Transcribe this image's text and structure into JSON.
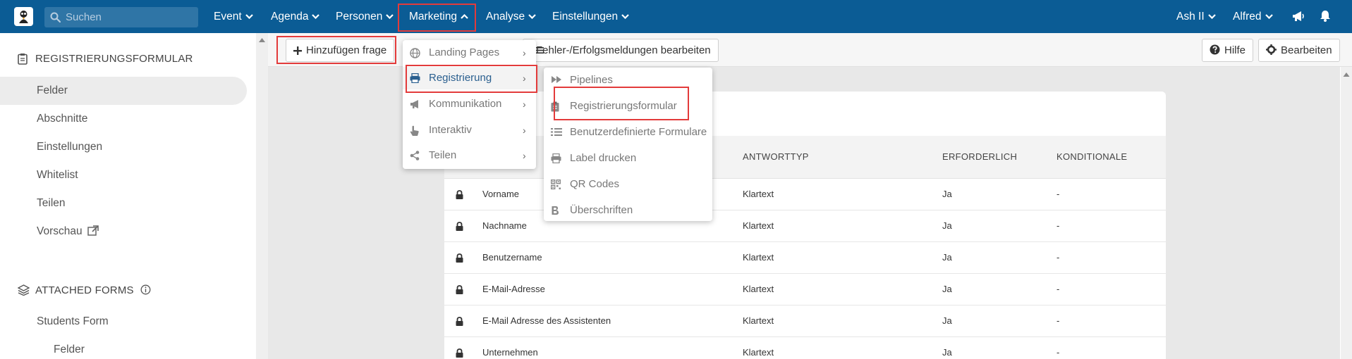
{
  "colors": {
    "topbar": "#0b5c95",
    "highlight": "#e33b3b",
    "active_menu_text": "#2a5f8f"
  },
  "topbar": {
    "search_placeholder": "Suchen",
    "nav": [
      "Event",
      "Agenda",
      "Personen",
      "Marketing",
      "Analyse",
      "Einstellungen"
    ],
    "user_menus": [
      "Ash II",
      "Alfred"
    ],
    "icons": [
      "megaphone-icon",
      "bell-icon"
    ]
  },
  "sidebar": {
    "section_title": "REGISTRIERUNGSFORMULAR",
    "items": [
      "Felder",
      "Abschnitte",
      "Einstellungen",
      "Whitelist",
      "Teilen",
      "Vorschau"
    ],
    "attached_title": "ATTACHED FORMS",
    "attached_items": [
      "Students Form",
      "Felder"
    ]
  },
  "toolbar": {
    "add_question": "Hinzufügen frage",
    "edit_messages": "Fehler-/Erfolgsmeldungen bearbeiten",
    "help": "Hilfe",
    "edit": "Bearbeiten"
  },
  "marketing_menu": {
    "items": [
      {
        "label": "Landing Pages",
        "icon": "globe-icon"
      },
      {
        "label": "Registrierung",
        "icon": "printer-icon"
      },
      {
        "label": "Kommunikation",
        "icon": "megaphone-icon"
      },
      {
        "label": "Interaktiv",
        "icon": "hand-pointer-icon"
      },
      {
        "label": "Teilen",
        "icon": "share-icon"
      }
    ],
    "active": "Registrierung"
  },
  "registrierung_menu": {
    "items": [
      {
        "label": "Pipelines",
        "icon": "fast-forward-icon"
      },
      {
        "label": "Registrierungsformular",
        "icon": "clipboard-icon"
      },
      {
        "label": "Benutzerdefinierte Formulare",
        "icon": "list-icon"
      },
      {
        "label": "Label drucken",
        "icon": "printer-icon"
      },
      {
        "label": "QR Codes",
        "icon": "qrcode-icon"
      },
      {
        "label": "Überschriften",
        "icon": "bold-icon"
      }
    ]
  },
  "table": {
    "columns": [
      "ANTWORTTYP",
      "ERFORDERLICH",
      "KONDITIONALE"
    ],
    "rows": [
      {
        "field": "Vorname",
        "type": "Klartext",
        "required": "Ja",
        "conditional": "-"
      },
      {
        "field": "Nachname",
        "type": "Klartext",
        "required": "Ja",
        "conditional": "-"
      },
      {
        "field": "Benutzername",
        "type": "Klartext",
        "required": "Ja",
        "conditional": "-"
      },
      {
        "field": "E-Mail-Adresse",
        "type": "Klartext",
        "required": "Ja",
        "conditional": "-"
      },
      {
        "field": "E-Mail Adresse des Assistenten",
        "type": "Klartext",
        "required": "Ja",
        "conditional": "-"
      },
      {
        "field": "Unternehmen",
        "type": "Klartext",
        "required": "Ja",
        "conditional": "-"
      }
    ]
  }
}
